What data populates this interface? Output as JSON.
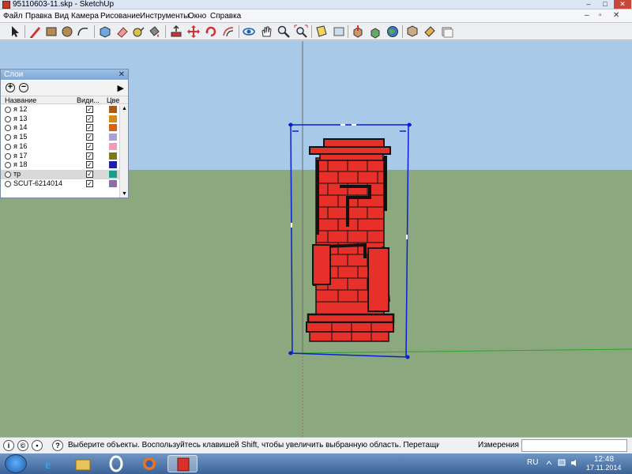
{
  "window": {
    "title": "95110603-11.skp - SketchUp",
    "minimize": "–",
    "maximize": "□",
    "close": "✕"
  },
  "menu": [
    "Файл",
    "Правка",
    "Вид",
    "Камера",
    "Рисование",
    "Инструменты",
    "Окно",
    "Справка"
  ],
  "toolbar_icons": [
    "select-arrow-icon",
    "pencil-line-icon",
    "rectangle-icon",
    "circle-icon",
    "arc-icon",
    "make-component-icon",
    "eraser-icon",
    "tape-measure-icon",
    "paint-bucket-icon",
    "push-pull-icon",
    "move-icon",
    "rotate-icon",
    "offset-icon",
    "orbit-icon",
    "pan-hand-icon",
    "zoom-icon",
    "zoom-extents-icon",
    "section-plane-icon",
    "xray-icon",
    "get-models-icon",
    "share-model-icon",
    "google-earth-icon",
    "components-icon",
    "materials-icon",
    "styles-icon"
  ],
  "layers_panel": {
    "title": "Слои",
    "close": "✕",
    "add": "+",
    "remove": "−",
    "details": "▶",
    "col_name": "Название",
    "col_visible": "Види...",
    "col_color": "Цве",
    "rows": [
      {
        "name": "я 12",
        "visible": true,
        "color": "#a55a18",
        "active": false
      },
      {
        "name": "я 13",
        "visible": true,
        "color": "#d58a1d",
        "active": false
      },
      {
        "name": "я 14",
        "visible": true,
        "color": "#d9620f",
        "active": false
      },
      {
        "name": "я 15",
        "visible": true,
        "color": "#a8a0d6",
        "active": false
      },
      {
        "name": "я 16",
        "visible": true,
        "color": "#f29bb8",
        "active": false
      },
      {
        "name": "я 17",
        "visible": true,
        "color": "#7e7a1a",
        "active": false
      },
      {
        "name": "я 18",
        "visible": true,
        "color": "#1f1fa8",
        "active": false
      },
      {
        "name": "тр",
        "visible": true,
        "color": "#1a9c8a",
        "active": true
      },
      {
        "name": "SCUT-6214014",
        "visible": true,
        "color": "#8a6fa6",
        "active": false
      }
    ]
  },
  "status": {
    "message": "Выберите объекты. Воспользуйтесь клавишей Shift, чтобы увеличить выбранную область. Перетащите мышь, ч",
    "measurements_label": "Измерения",
    "measurements_value": "",
    "icons": [
      "geo-location-icon",
      "credits-icon",
      "user-icon",
      "help-icon"
    ]
  },
  "taskbar": {
    "apps": [
      "internet-explorer-icon",
      "file-explorer-icon",
      "opera-icon",
      "firefox-icon",
      "sketchup-icon"
    ],
    "active_app": "sketchup-icon",
    "lang": "RU",
    "time": "12:48",
    "date": "17.11.2014"
  },
  "colors": {
    "sky": "#a9c9e9",
    "ground": "#8ca87e",
    "brick": "#e8302a",
    "selection": "#0a1fd6"
  }
}
